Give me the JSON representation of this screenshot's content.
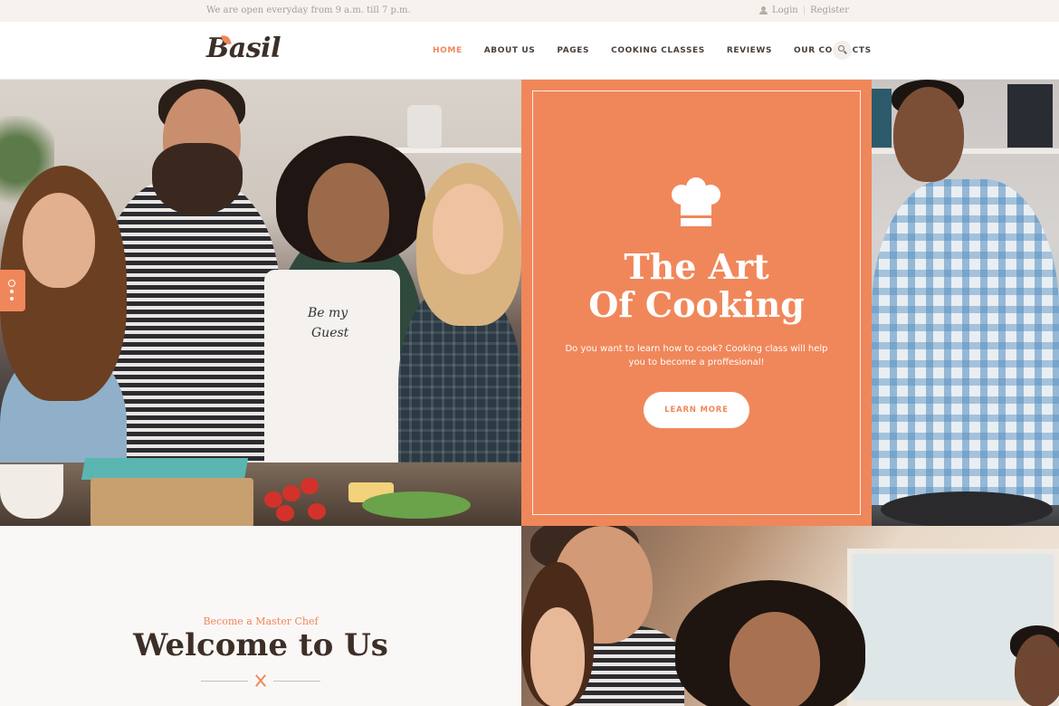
{
  "topbar": {
    "hours": "We are open everyday from 9 a.m. till 7 p.m.",
    "login": "Login",
    "separator": "|",
    "register": "Register"
  },
  "header": {
    "logo": "Basil",
    "nav": [
      "HOME",
      "ABOUT US",
      "PAGES",
      "COOKING CLASSES",
      "REVIEWS",
      "OUR CONTACTS"
    ],
    "active_nav": "HOME"
  },
  "hero": {
    "title_line1": "The Art",
    "title_line2": "Of Cooking",
    "text_line1": "Do you want to learn how to cook? Cooking class will help",
    "text_line2": "you to become a proffesional!",
    "button": "LEARN MORE",
    "apron_text_line1": "Be my",
    "apron_text_line2": "Guest"
  },
  "welcome": {
    "subtitle": "Become a Master Chef",
    "title": "Welcome to Us"
  },
  "colors": {
    "accent": "#f0875a",
    "dark": "#3d2f28",
    "topbar_bg": "#f6f3ef"
  },
  "icons": [
    "user-icon",
    "search-icon",
    "chef-hat-icon",
    "utensils-icon",
    "slider-dots-icon"
  ]
}
